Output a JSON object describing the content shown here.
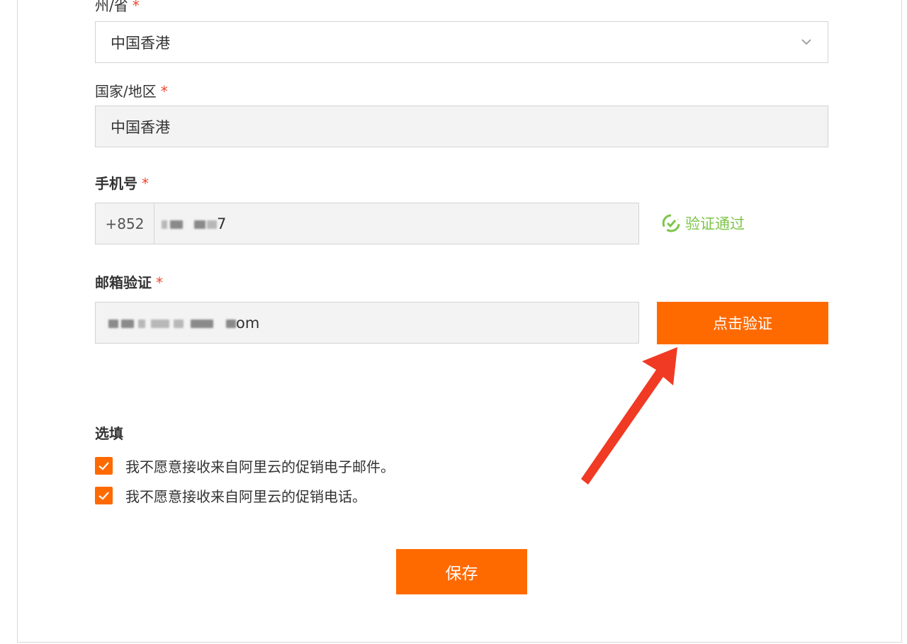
{
  "form": {
    "province": {
      "label": "州/省",
      "required_mark": "*",
      "value": "中国香港"
    },
    "country": {
      "label": "国家/地区",
      "required_mark": "*",
      "value": "中国香港"
    },
    "phone": {
      "label": "手机号",
      "required_mark": "*",
      "prefix": "+852",
      "value_tail": "7",
      "status": "验证通过"
    },
    "email": {
      "label": "邮箱验证",
      "required_mark": "*",
      "value_tail": "om",
      "verify_button": "点击验证"
    },
    "optional": {
      "title": "选填",
      "options": [
        {
          "label": "我不愿意接收来自阿里云的促销电子邮件。",
          "checked": true
        },
        {
          "label": "我不愿意接收来自阿里云的促销电话。",
          "checked": true
        }
      ]
    },
    "save_button": "保存"
  },
  "colors": {
    "accent": "#ff6a00",
    "success": "#7ec54a",
    "required": "#f0442b",
    "arrow": "#f03a24"
  },
  "icons": {
    "select": "chevron-down-icon",
    "verified": "check-circle-icon",
    "checkbox": "checkmark-icon",
    "annotation": "red-arrow"
  }
}
